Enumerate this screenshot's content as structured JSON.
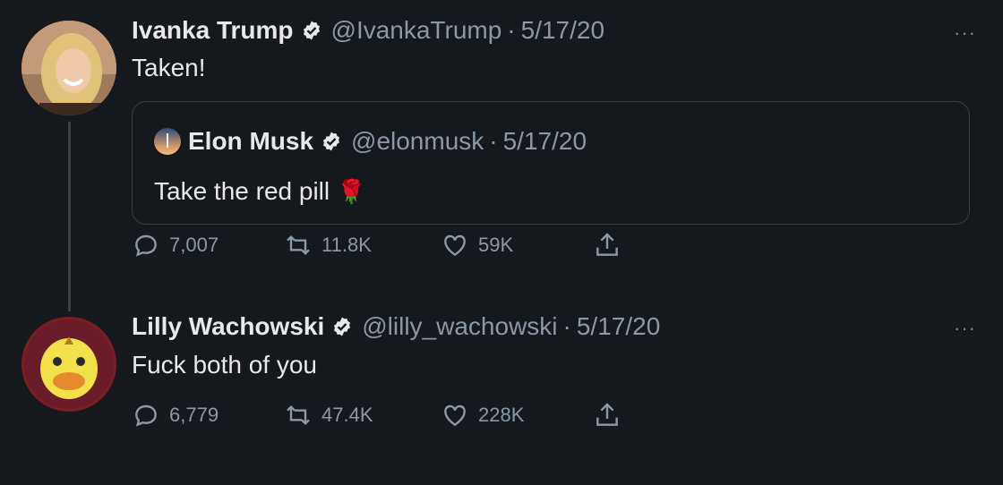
{
  "tweets": [
    {
      "name": "Ivanka Trump",
      "handle": "@IvankaTrump",
      "separator": "·",
      "date": "5/17/20",
      "text": "Taken!",
      "more": "···",
      "quote": {
        "name": "Elon Musk",
        "handle": "@elonmusk",
        "separator": "·",
        "date": "5/17/20",
        "text": "Take the red pill",
        "emoji": "🌹"
      },
      "replies": "7,007",
      "retweets": "11.8K",
      "likes": "59K"
    },
    {
      "name": "Lilly Wachowski",
      "handle": "@lilly_wachowski",
      "separator": "·",
      "date": "5/17/20",
      "text": "Fuck both of you",
      "more": "···",
      "replies": "6,779",
      "retweets": "47.4K",
      "likes": "228K"
    }
  ],
  "colors": {
    "background": "#15181c",
    "text": "#e8e8e8",
    "muted": "#8b98a5",
    "verified": "#e8e8e8"
  }
}
